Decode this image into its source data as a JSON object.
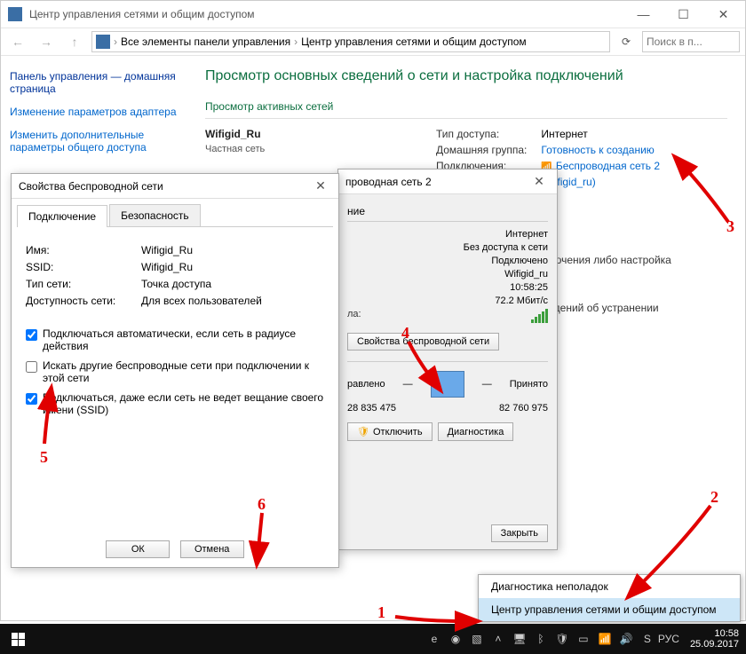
{
  "window": {
    "title": "Центр управления сетями и общим доступом",
    "breadcrumb": {
      "root": "Все элементы панели управления",
      "leaf": "Центр управления сетями и общим доступом"
    },
    "search_placeholder": "Поиск в п..."
  },
  "sidebar": {
    "header": "Панель управления — домашняя страница",
    "links": [
      "Изменение параметров адаптера",
      "Изменить дополнительные параметры общего доступа"
    ]
  },
  "content": {
    "heading": "Просмотр основных сведений о сети и настройка подключений",
    "active_heading": "Просмотр активных сетей",
    "net_name": "Wifigid_Ru",
    "net_type": "Частная сеть",
    "labels": {
      "access": "Тип доступа:",
      "homegroup": "Домашняя группа:",
      "connections": "Подключения:"
    },
    "values": {
      "access": "Интернет",
      "homegroup": "Готовность к созданию",
      "conn_main": "Беспроводная сеть 2",
      "conn_sub": "(Wifigid_ru)"
    },
    "extra1": "ключения либо настройка",
    "extra2": "ведений об устранении"
  },
  "status_dialog": {
    "title": "проводная сеть 2",
    "section1": "ние",
    "rows1": [
      {
        "l": "",
        "r": "Интернет"
      },
      {
        "l": "",
        "r": "Без доступа к сети"
      },
      {
        "l": "",
        "r": "Подключено"
      },
      {
        "l": "",
        "r": "Wifigid_ru"
      },
      {
        "l": "",
        "r": "10:58:25"
      },
      {
        "l": "",
        "r": "72.2 Мбит/с"
      }
    ],
    "section2": "ла:",
    "btn_details": "...",
    "btn_props": "Свойства беспроводной сети",
    "activity": {
      "sent_label": "равлено",
      "recv_label": "Принято",
      "sent": "28 835 475",
      "recv": "82 760 975"
    },
    "btn_disable": "Отключить",
    "btn_diag": "Диагностика",
    "btn_close": "Закрыть"
  },
  "props_dialog": {
    "title": "Свойства беспроводной сети",
    "tabs": [
      "Подключение",
      "Безопасность"
    ],
    "rows": [
      {
        "l": "Имя:",
        "r": "Wifigid_Ru"
      },
      {
        "l": "SSID:",
        "r": "Wifigid_Ru"
      },
      {
        "l": "Тип сети:",
        "r": "Точка доступа"
      },
      {
        "l": "Доступность сети:",
        "r": "Для всех пользователей"
      }
    ],
    "chk1": "Подключаться автоматически, если сеть в радиусе действия",
    "chk2": "Искать другие беспроводные сети при подключении к этой сети",
    "chk3": "Подключаться, даже если сеть не ведет вещание своего имени (SSID)",
    "ok": "ОК",
    "cancel": "Отмена"
  },
  "context_menu": {
    "item1": "Диагностика неполадок",
    "item2": "Центр управления сетями и общим доступом"
  },
  "taskbar": {
    "lang": "РУС",
    "time": "10:58",
    "date": "25.09.2017"
  },
  "annotations": [
    "1",
    "2",
    "3",
    "4",
    "5",
    "6"
  ]
}
